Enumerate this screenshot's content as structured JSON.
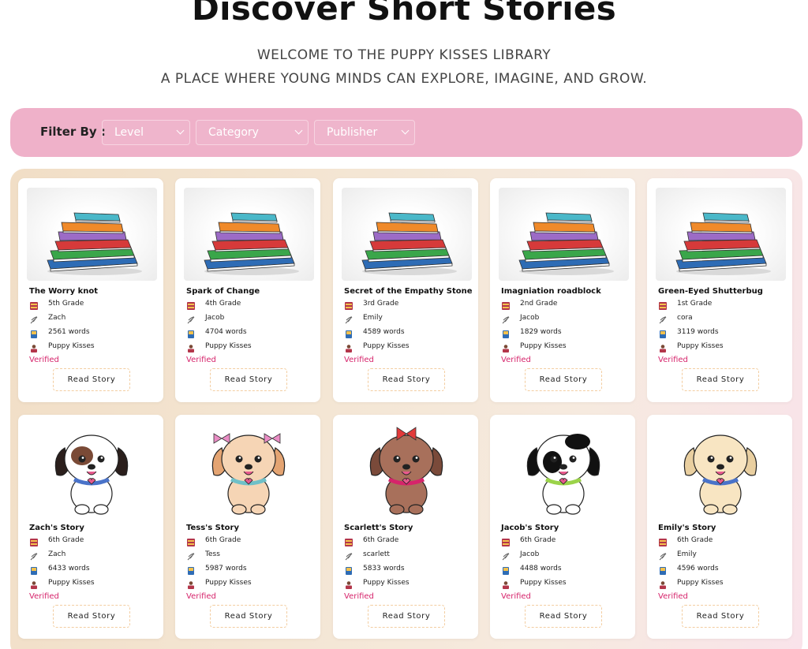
{
  "header": {
    "title": "Discover Short Stories",
    "subtitle_line1": "WELCOME TO THE PUPPY KISSES LIBRARY",
    "subtitle_line2": "A PLACE WHERE YOUNG MINDS CAN EXPLORE, IMAGINE, AND GROW."
  },
  "filter": {
    "label": "Filter By :",
    "level_selected": "Level",
    "category_selected": "Category",
    "publisher_selected": "Publisher"
  },
  "colors": {
    "filter_bar": "#efb1c9",
    "verified": "#d6246b",
    "button_border": "#f3cda0"
  },
  "stories": [
    {
      "title": "The Worry knot",
      "grade": "5th Grade",
      "author": "Zach",
      "words": "2561 words",
      "publisher": "Puppy Kisses",
      "status": "Verified",
      "button": "Read Story",
      "image": "book-stack"
    },
    {
      "title": "Spark of Change",
      "grade": "4th Grade",
      "author": "Jacob",
      "words": "4704 words",
      "publisher": "Puppy Kisses",
      "status": "Verified",
      "button": "Read Story",
      "image": "book-stack"
    },
    {
      "title": "Secret of the Empathy Stone",
      "grade": "3rd Grade",
      "author": "Emily",
      "words": "4589 words",
      "publisher": "Puppy Kisses",
      "status": "Verified",
      "button": "Read Story",
      "image": "book-stack"
    },
    {
      "title": "Imagniation roadblock",
      "grade": "2nd Grade",
      "author": "Jacob",
      "words": "1829 words",
      "publisher": "Puppy Kisses",
      "status": "Verified",
      "button": "Read Story",
      "image": "book-stack"
    },
    {
      "title": "Green-Eyed Shutterbug",
      "grade": "1st Grade",
      "author": "cora",
      "words": "3119 words",
      "publisher": "Puppy Kisses",
      "status": "Verified",
      "button": "Read Story",
      "image": "book-stack"
    },
    {
      "title": "Zach's Story",
      "grade": "6th Grade",
      "author": "Zach",
      "words": "6433 words",
      "publisher": "Puppy Kisses",
      "status": "Verified",
      "button": "Read Story",
      "image": "puppy-spotted"
    },
    {
      "title": "Tess's Story",
      "grade": "6th Grade",
      "author": "Tess",
      "words": "5987 words",
      "publisher": "Puppy Kisses",
      "status": "Verified",
      "button": "Read Story",
      "image": "puppy-cocker"
    },
    {
      "title": "Scarlett's Story",
      "grade": "6th Grade",
      "author": "scarlett",
      "words": "5833 words",
      "publisher": "Puppy Kisses",
      "status": "Verified",
      "button": "Read Story",
      "image": "puppy-yorkie"
    },
    {
      "title": "Jacob's Story",
      "grade": "6th Grade",
      "author": "Jacob",
      "words": "4488 words",
      "publisher": "Puppy Kisses",
      "status": "Verified",
      "button": "Read Story",
      "image": "puppy-dalmatian"
    },
    {
      "title": "Emily's Story",
      "grade": "6th Grade",
      "author": "Emily",
      "words": "4596 words",
      "publisher": "Puppy Kisses",
      "status": "Verified",
      "button": "Read Story",
      "image": "puppy-golden"
    }
  ],
  "meta_icons": [
    "grade-book-icon",
    "author-quill-icon",
    "word-count-book-icon",
    "publisher-reader-icon"
  ]
}
